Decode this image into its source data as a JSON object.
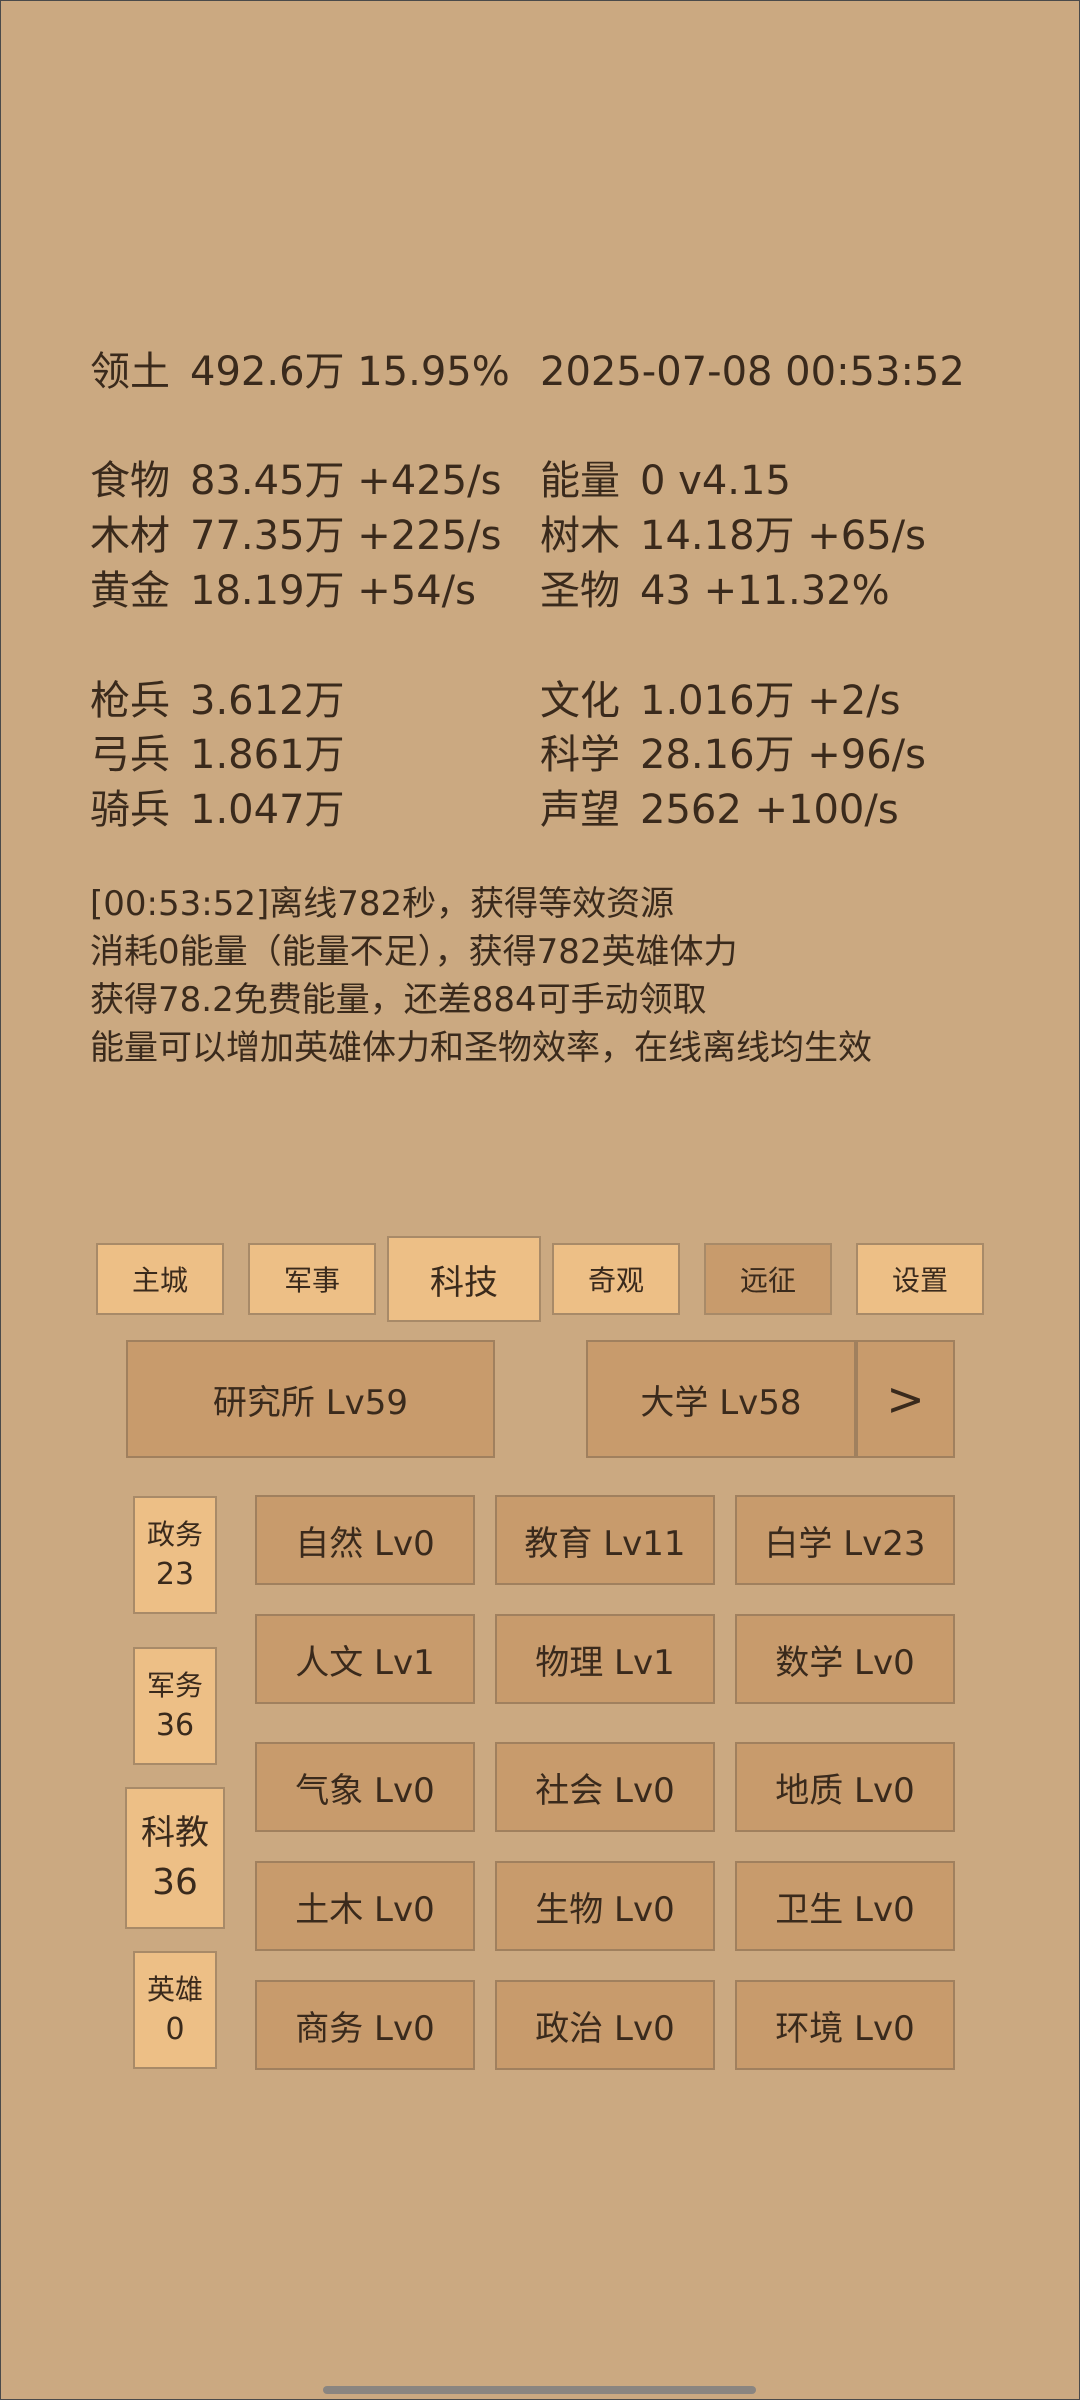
{
  "header": {
    "territory_label": "领土",
    "territory_value": "492.6万  15.95%",
    "datetime": "2025-07-08 00:53:52"
  },
  "resources_left": [
    {
      "label": "食物",
      "value": "83.45万 +425/s"
    },
    {
      "label": "木材",
      "value": "77.35万 +225/s"
    },
    {
      "label": "黄金",
      "value": "18.19万 +54/s"
    }
  ],
  "resources_right": [
    {
      "label": "能量",
      "value": "0  v4.15"
    },
    {
      "label": "树木",
      "value": "14.18万 +65/s"
    },
    {
      "label": "圣物",
      "value": "43 +11.32%"
    }
  ],
  "military_left": [
    {
      "label": "枪兵",
      "value": "3.612万"
    },
    {
      "label": "弓兵",
      "value": "1.861万"
    },
    {
      "label": "骑兵",
      "value": "1.047万"
    }
  ],
  "military_right": [
    {
      "label": "文化",
      "value": "1.016万 +2/s"
    },
    {
      "label": "科学",
      "value": "28.16万 +96/s"
    },
    {
      "label": "声望",
      "value": "2562 +100/s"
    }
  ],
  "log": [
    "[00:53:52]离线782秒，获得等效资源",
    "消耗0能量（能量不足），获得782英雄体力",
    "获得78.2免费能量，还差884可手动领取",
    "能量可以增加英雄体力和圣物效率，在线离线均生效"
  ],
  "tabs": [
    "主城",
    "军事",
    "科技",
    "奇观",
    "远征",
    "设置"
  ],
  "buildings": {
    "institute": "研究所 Lv59",
    "university": "大学 Lv58",
    "next": ">"
  },
  "side": [
    {
      "title": "政务",
      "count": "23"
    },
    {
      "title": "军务",
      "count": "36"
    },
    {
      "title": "科教",
      "count": "36"
    },
    {
      "title": "英雄",
      "count": "0"
    }
  ],
  "tech": [
    [
      "自然 Lv0",
      "教育 Lv11",
      "白学 Lv23"
    ],
    [
      "人文 Lv1",
      "物理 Lv1",
      "数学 Lv0"
    ],
    [
      "气象 Lv0",
      "社会 Lv0",
      "地质 Lv0"
    ],
    [
      "土木 Lv0",
      "生物 Lv0",
      "卫生 Lv0"
    ],
    [
      "商务 Lv0",
      "政治 Lv0",
      "环境 Lv0"
    ]
  ]
}
